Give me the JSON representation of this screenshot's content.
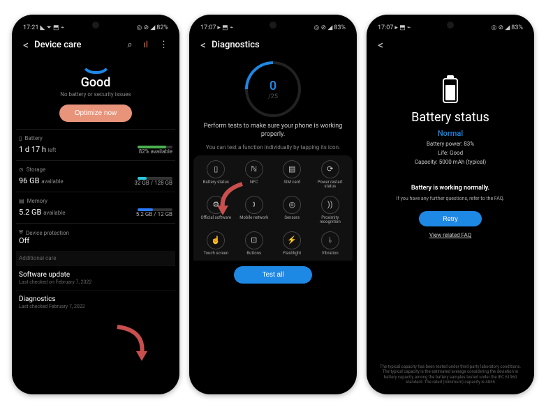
{
  "phone1": {
    "status": {
      "time": "17:21",
      "battery": "82%",
      "icons_left": "◣ ⏷ ⬒ ⌁",
      "icons_right": "◎ ⊘ ◢"
    },
    "header": {
      "back": "<",
      "title": "Device care",
      "search_icon": "⌕",
      "bars_icon": "ıl",
      "more_icon": "⋮"
    },
    "good": "Good",
    "subtitle": "No battery or security issues",
    "optimize": "Optimize now",
    "battery": {
      "icon": "▯",
      "label": "Battery",
      "main": "1 d 17 h",
      "main_suffix": "left",
      "right": "82% available",
      "fill_pct": 82,
      "fill_color": "#4caf50"
    },
    "storage": {
      "icon": "⊙",
      "label": "Storage",
      "main": "96 GB",
      "main_suffix": "available",
      "right": "32 GB / 128 GB",
      "fill_pct": 25,
      "fill_color": "#26c6da"
    },
    "memory": {
      "icon": "▤",
      "label": "Memory",
      "main": "5.2 GB",
      "main_suffix": "available",
      "right": "5.2 GB / 12 GB",
      "fill_pct": 43,
      "fill_color": "#2979ff"
    },
    "protection": {
      "icon": "⛨",
      "label": "Device protection",
      "main": "Off"
    },
    "additional": "Additional care",
    "software_update": {
      "title": "Software update",
      "sub": "Last checked on February 7, 2022"
    },
    "diagnostics": {
      "title": "Diagnostics",
      "sub": "Last checked February 7, 2022"
    }
  },
  "phone2": {
    "status": {
      "time": "17:07",
      "battery": "83%",
      "icons_left": "▸ ⬒ ⌁",
      "icons_right": "◎ ⊘ ◢"
    },
    "header": {
      "back": "<",
      "title": "Diagnostics"
    },
    "ring": {
      "num": "0",
      "total": "/25"
    },
    "desc": "Perform tests to make sure your phone is working properly.",
    "hint": "You can test a function individually by tapping its icon.",
    "grid": [
      {
        "icon": "▯",
        "label": "Battery status"
      },
      {
        "icon": "ℕ",
        "label": "NFC"
      },
      {
        "icon": "▤",
        "label": "SIM card"
      },
      {
        "icon": "⟳",
        "label": "Power restart status"
      },
      {
        "icon": "⚙",
        "label": "Official software"
      },
      {
        "icon": "🕽",
        "label": "Mobile network"
      },
      {
        "icon": "◎",
        "label": "Sensors"
      },
      {
        "icon": "))",
        "label": "Proximity recognition"
      },
      {
        "icon": "☝",
        "label": "Touch screen"
      },
      {
        "icon": "⊡",
        "label": "Buttons"
      },
      {
        "icon": "⚡",
        "label": "Flashlight"
      },
      {
        "icon": "⫰",
        "label": "Vibration"
      }
    ],
    "test_all": "Test all"
  },
  "phone3": {
    "status": {
      "time": "17:07",
      "battery": "83%",
      "icons_left": "▸ ⬒ ⌁",
      "icons_right": "◎ ⊘ ◢"
    },
    "header": {
      "back": "<"
    },
    "title": "Battery status",
    "status_text": "Normal",
    "power": "Battery power: 83%",
    "life": "Life: Good",
    "capacity": "Capacity: 5000 mAh (typical)",
    "working": "Battery is working normally.",
    "faq_note": "If you have any further questions, refer to the FAQ.",
    "retry": "Retry",
    "link": "View related FAQ",
    "fine": "The typical capacity has been tested under third-party laboratory conditions. The typical capacity is the estimated average considering the deviation in battery capacity among the battery samples tested under the IEC 61960 standard. The rated (minimum) capacity is 4855"
  }
}
